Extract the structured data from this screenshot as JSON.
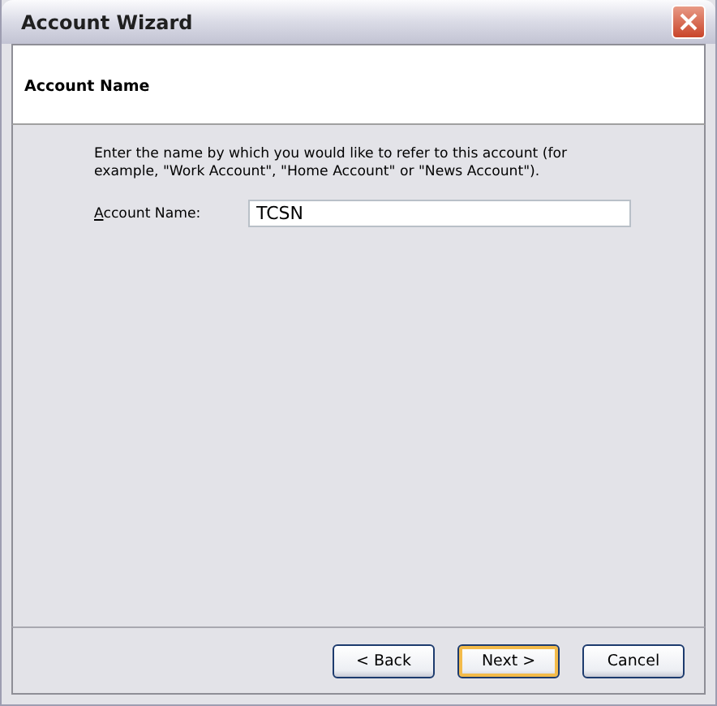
{
  "window": {
    "title": "Account Wizard"
  },
  "header": {
    "title": "Account Name"
  },
  "instructions": "Enter the name by which you would like to refer to this account (for example, \"Work Account\", \"Home Account\" or \"News Account\").",
  "field": {
    "label": "Account Name:",
    "access_key_underlined": true,
    "value": "TCSN"
  },
  "buttons": [
    {
      "label": "< Back",
      "default": false
    },
    {
      "label": "Next >",
      "default": true
    },
    {
      "label": "Cancel",
      "default": false
    }
  ]
}
